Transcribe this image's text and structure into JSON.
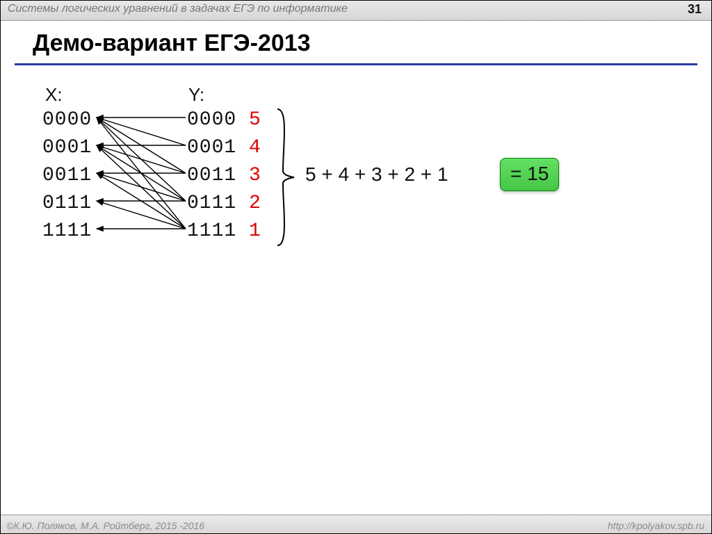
{
  "header": {
    "title": "Системы логических уравнений в задачах ЕГЭ по информатике",
    "page": "31"
  },
  "slide": {
    "title": "Демо-вариант ЕГЭ-2013"
  },
  "labels": {
    "x": "X:",
    "y": "Y:"
  },
  "x": [
    "0000",
    "0001",
    "0011",
    "0111",
    "1111"
  ],
  "y": [
    {
      "bits": "0000",
      "count": "5"
    },
    {
      "bits": "0001",
      "count": "4"
    },
    {
      "bits": "0011",
      "count": "3"
    },
    {
      "bits": "0111",
      "count": "2"
    },
    {
      "bits": "1111",
      "count": "1"
    }
  ],
  "sum": {
    "expr": "5 + 4 + 3 + 2 + 1",
    "result": "= 15"
  },
  "arrows": [
    [
      0,
      0
    ],
    [
      1,
      0
    ],
    [
      2,
      0
    ],
    [
      3,
      0
    ],
    [
      4,
      0
    ],
    [
      1,
      1
    ],
    [
      2,
      1
    ],
    [
      3,
      1
    ],
    [
      4,
      1
    ],
    [
      2,
      2
    ],
    [
      3,
      2
    ],
    [
      4,
      2
    ],
    [
      3,
      3
    ],
    [
      4,
      3
    ],
    [
      4,
      4
    ]
  ],
  "footer": {
    "left": "©К.Ю. Поляков, М.А. Ройтберг, 2015 -2016",
    "right": "http://kpolyakov.spb.ru"
  }
}
